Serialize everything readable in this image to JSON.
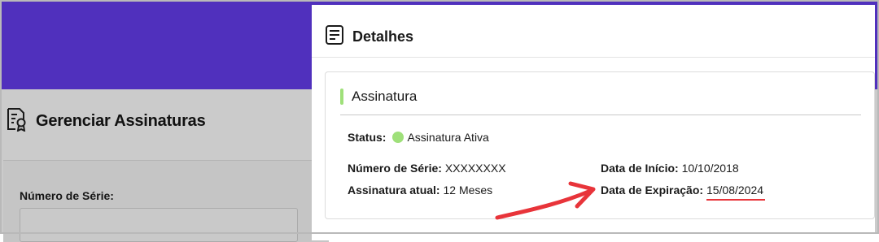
{
  "colors": {
    "header_purple": "#5030bd",
    "overlay_gray": "#cbcbcb",
    "accent_green": "#9fe07a",
    "status_green": "#9fe07a",
    "annotation_red": "#e8343a"
  },
  "background": {
    "title": "Gerenciar Assinaturas",
    "title_icon": "certificate-icon",
    "serial_label": "Número de Série:"
  },
  "panel": {
    "title": "Detalhes",
    "title_icon": "document-lines-icon",
    "card": {
      "title": "Assinatura",
      "status_label": "Status:",
      "status_value": "Assinatura Ativa",
      "serial_label": "Número de Série:",
      "serial_value": "XXXXXXXX",
      "current_label": "Assinatura atual:",
      "current_value": "12 Meses",
      "start_label": "Data de Início:",
      "start_value": "10/10/2018",
      "expiry_label": "Data de Expiração:",
      "expiry_value": "15/08/2024"
    }
  },
  "annotation": {
    "arrow_icon": "red-arrow-annotation",
    "underline": "red-underline-annotation"
  }
}
